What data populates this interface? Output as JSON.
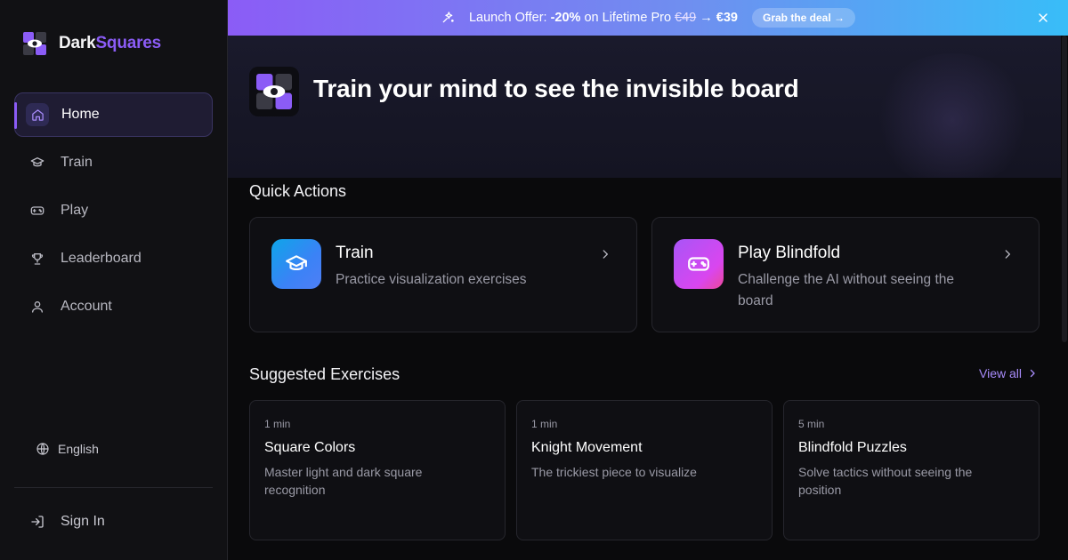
{
  "brand": {
    "name_main": "Dark",
    "name_accent": "Squares"
  },
  "sidebar": {
    "items": [
      {
        "label": "Home",
        "icon": "home-icon",
        "active": true
      },
      {
        "label": "Train",
        "icon": "graduation-cap-icon",
        "active": false
      },
      {
        "label": "Play",
        "icon": "gamepad-icon",
        "active": false
      },
      {
        "label": "Leaderboard",
        "icon": "trophy-icon",
        "active": false
      },
      {
        "label": "Account",
        "icon": "user-icon",
        "active": false
      }
    ],
    "language": "English",
    "sign_in": "Sign In"
  },
  "banner": {
    "prefix": "Launch Offer: ",
    "discount": "-20%",
    "middle": " on Lifetime Pro ",
    "old_price": "€49",
    "arrow": " → ",
    "new_price": "€39",
    "cta": "Grab the deal →"
  },
  "hero": {
    "title": "Train your mind to see the invisible board"
  },
  "quick_actions": {
    "title": "Quick Actions",
    "cards": [
      {
        "title": "Train",
        "description": "Practice visualization exercises",
        "icon": "graduation-cap-icon"
      },
      {
        "title": "Play Blindfold",
        "description": "Challenge the AI without seeing the board",
        "icon": "gamepad-icon"
      }
    ]
  },
  "suggested": {
    "title": "Suggested Exercises",
    "view_all": "View all",
    "exercises": [
      {
        "duration": "1 min",
        "title": "Square Colors",
        "description": "Master light and dark square recognition"
      },
      {
        "duration": "1 min",
        "title": "Knight Movement",
        "description": "The trickiest piece to visualize"
      },
      {
        "duration": "5 min",
        "title": "Blindfold Puzzles",
        "description": "Solve tactics without seeing the position"
      }
    ]
  },
  "colors": {
    "accent": "#8b5cf6",
    "background": "#0a0a0c",
    "sidebar": "#111114"
  }
}
